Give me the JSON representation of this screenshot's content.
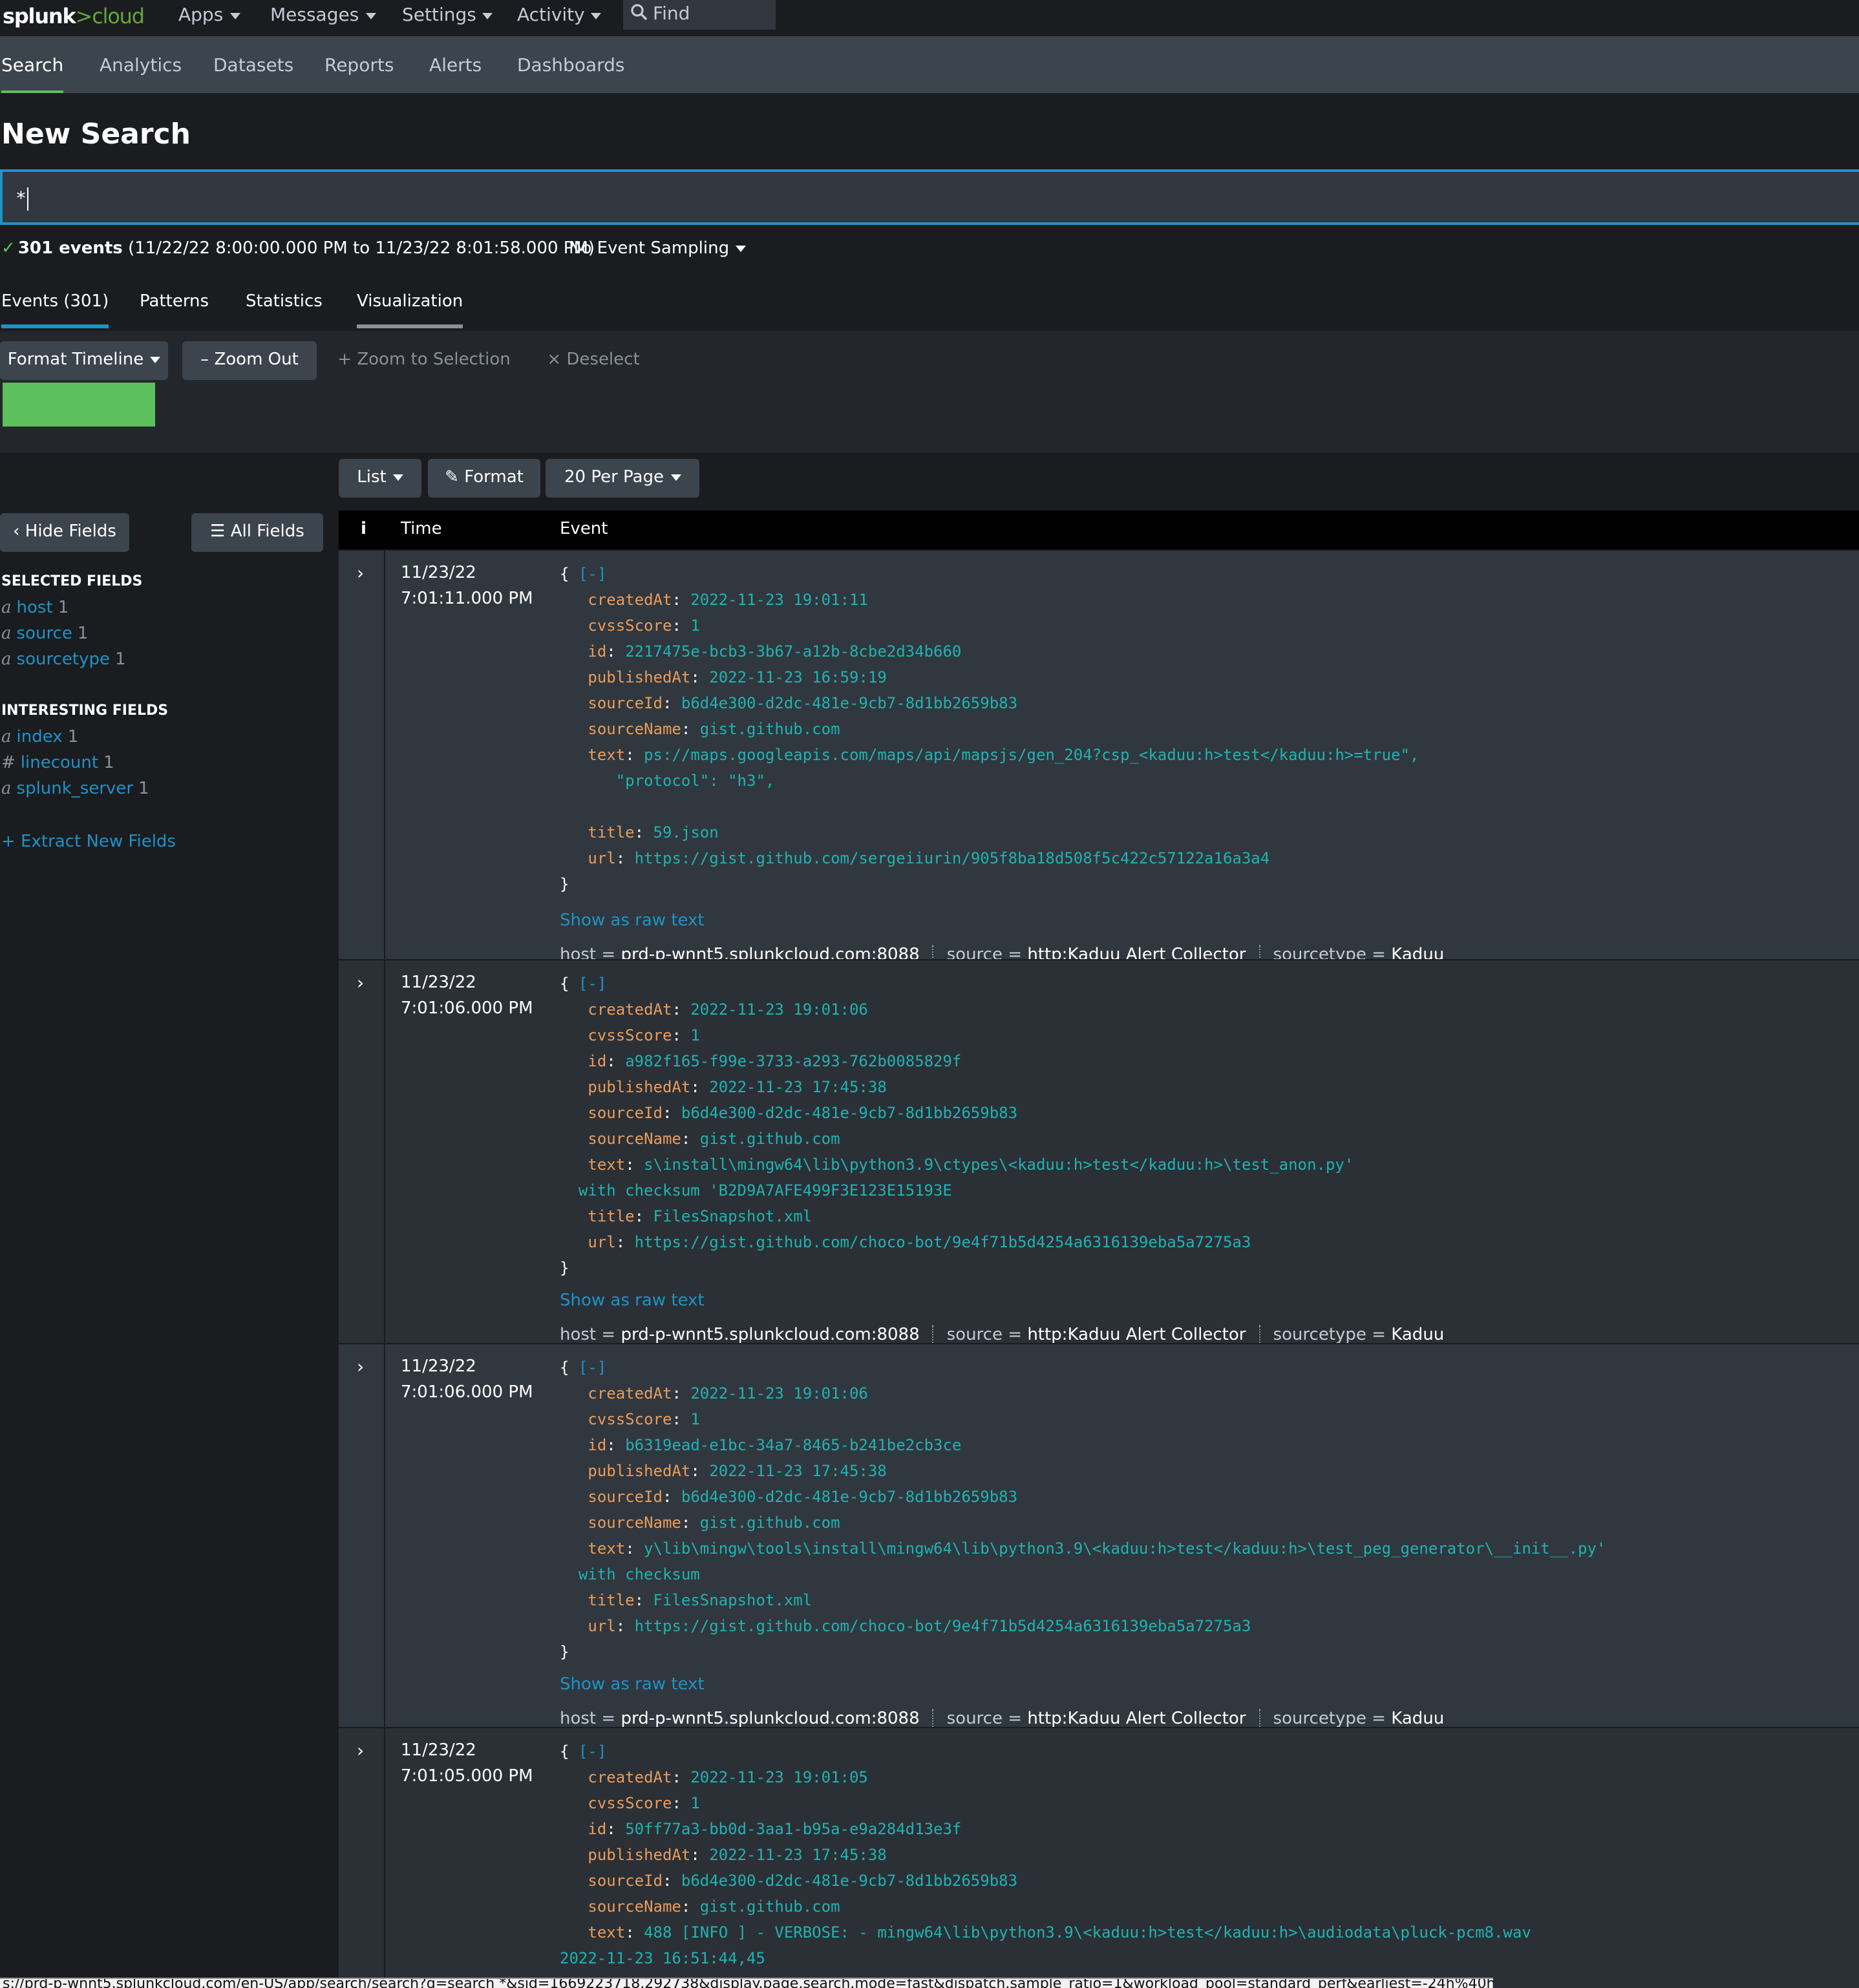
{
  "brand": {
    "splunk": "splunk",
    "gt": ">",
    "cloud": "cloud"
  },
  "topnav": {
    "apps": "Apps",
    "messages": "Messages",
    "settings": "Settings",
    "activity": "Activity",
    "find": "Find"
  },
  "appnav": {
    "search": "Search",
    "analytics": "Analytics",
    "datasets": "Datasets",
    "reports": "Reports",
    "alerts": "Alerts",
    "dashboards": "Dashboards"
  },
  "page": {
    "title": "New Search"
  },
  "search": {
    "query": "*"
  },
  "status": {
    "count": "301 events",
    "range": "(11/22/22 8:00:00.000 PM to 11/23/22 8:01:58.000 PM)",
    "sampling": "No Event Sampling"
  },
  "results_tabs": {
    "events": "Events (301)",
    "patterns": "Patterns",
    "statistics": "Statistics",
    "visualization": "Visualization"
  },
  "timeline": {
    "format": "Format Timeline",
    "zoom_out": "Zoom Out",
    "zoom_sel": "Zoom to Selection",
    "deselect": "Deselect"
  },
  "list_tools": {
    "list": "List",
    "format": "Format",
    "per_page": "20 Per Page"
  },
  "sidebar": {
    "hide": "Hide Fields",
    "all": "All Fields",
    "selected_title": "SELECTED FIELDS",
    "selected": [
      {
        "type": "a",
        "name": "host",
        "count": "1"
      },
      {
        "type": "a",
        "name": "source",
        "count": "1"
      },
      {
        "type": "a",
        "name": "sourcetype",
        "count": "1"
      }
    ],
    "interesting_title": "INTERESTING FIELDS",
    "interesting": [
      {
        "type": "a",
        "name": "index",
        "count": "1"
      },
      {
        "type": "#",
        "name": "linecount",
        "count": "1"
      },
      {
        "type": "a",
        "name": "splunk_server",
        "count": "1"
      }
    ],
    "extract": "Extract New Fields"
  },
  "table": {
    "i": "i",
    "time": "Time",
    "event": "Event"
  },
  "events": [
    {
      "date": "11/23/22",
      "time": "7:01:11.000 PM",
      "createdAt": "2022-11-23 19:01:11",
      "cvssScore": "1",
      "id": "2217475e-bcb3-3b67-a12b-8cbe2d34b660",
      "publishedAt": "2022-11-23 16:59:19",
      "sourceId": "b6d4e300-d2dc-481e-9cb7-8d1bb2659b83",
      "sourceName": "gist.github.com",
      "text1": "ps://maps.googleapis.com/maps/api/mapsjs/gen_204?csp_<kaduu:h>test</kaduu:h>=true\",",
      "text2": "\"protocol\": \"h3\",",
      "title": "59.json",
      "url": "https://gist.github.com/sergeiiurin/905f8ba18d508f5c422c57122a16a3a4"
    },
    {
      "date": "11/23/22",
      "time": "7:01:06.000 PM",
      "createdAt": "2022-11-23 19:01:06",
      "cvssScore": "1",
      "id": "a982f165-f99e-3733-a293-762b0085829f",
      "publishedAt": "2022-11-23 17:45:38",
      "sourceId": "b6d4e300-d2dc-481e-9cb7-8d1bb2659b83",
      "sourceName": "gist.github.com",
      "text1": "s\\install\\mingw64\\lib\\python3.9\\ctypes\\<kaduu:h>test</kaduu:h>\\test_anon.py'",
      "text2": "with checksum 'B2D9A7AFE499F3E123E15193E",
      "title": "FilesSnapshot.xml",
      "url": "https://gist.github.com/choco-bot/9e4f71b5d4254a6316139eba5a7275a3"
    },
    {
      "date": "11/23/22",
      "time": "7:01:06.000 PM",
      "createdAt": "2022-11-23 19:01:06",
      "cvssScore": "1",
      "id": "b6319ead-e1bc-34a7-8465-b241be2cb3ce",
      "publishedAt": "2022-11-23 17:45:38",
      "sourceId": "b6d4e300-d2dc-481e-9cb7-8d1bb2659b83",
      "sourceName": "gist.github.com",
      "text1": "y\\lib\\mingw\\tools\\install\\mingw64\\lib\\python3.9\\<kaduu:h>test</kaduu:h>\\test_peg_generator\\__init__.py'",
      "text2": "with checksum",
      "title": "FilesSnapshot.xml",
      "url": "https://gist.github.com/choco-bot/9e4f71b5d4254a6316139eba5a7275a3"
    },
    {
      "date": "11/23/22",
      "time": "7:01:05.000 PM",
      "createdAt": "2022-11-23 19:01:05",
      "cvssScore": "1",
      "id": "50ff77a3-bb0d-3aa1-b95a-e9a284d13e3f",
      "publishedAt": "2022-11-23 17:45:38",
      "sourceId": "b6d4e300-d2dc-481e-9cb7-8d1bb2659b83",
      "sourceName": "gist.github.com",
      "text1": "488 [INFO ] - VERBOSE: - mingw64\\lib\\python3.9\\<kaduu:h>test</kaduu:h>\\audiodata\\pluck-pcm8.wav",
      "text2": "2022-11-23 16:51:44,45"
    }
  ],
  "common": {
    "open": "{",
    "close": "}",
    "collapse": "[-]",
    "raw": "Show as raw text",
    "host_key": "host =",
    "host": "prd-p-wnnt5.splunkcloud.com:8088",
    "source_key": "source =",
    "source": "http:Kaduu Alert Collector",
    "sourcetype_key": "sourcetype =",
    "sourcetype": "Kaduu"
  },
  "statusurl": "s://prd-p-wnnt5.splunkcloud.com/en-US/app/search/search?q=search *&sid=1669223718.292738&display.page.search.mode=fast&dispatch.sample_ratio=1&workload_pool=standard_perf&earliest=-24h%40h&latest=now#"
}
